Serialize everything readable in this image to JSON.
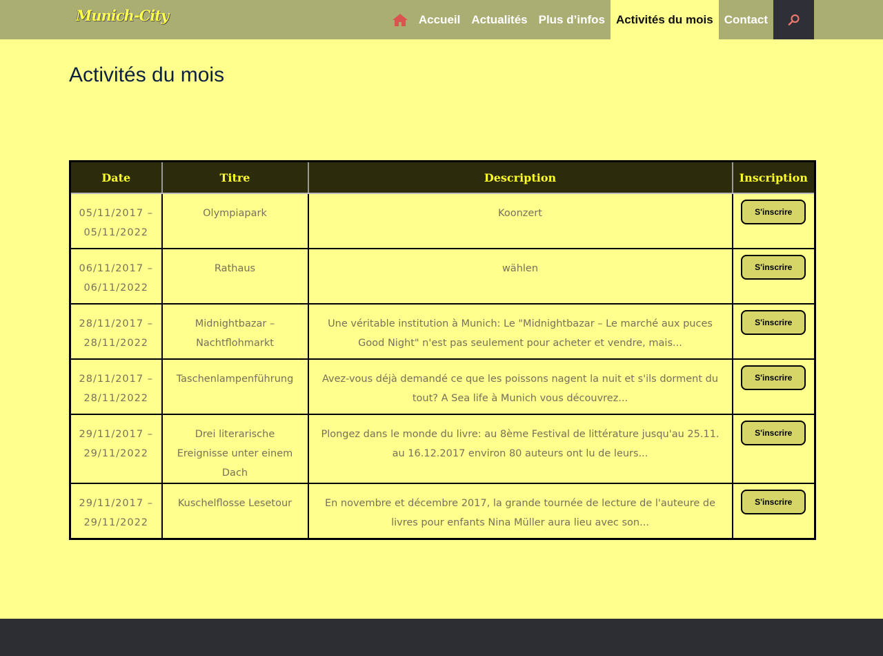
{
  "header": {
    "logo_text": "Munich-City",
    "nav": [
      {
        "label": "Accueil"
      },
      {
        "label": "Actualités"
      },
      {
        "label": "Plus d’infos"
      },
      {
        "label": "Activités du mois",
        "active": true
      },
      {
        "label": "Contact"
      }
    ],
    "icons": {
      "home": "home-icon",
      "search": "search-icon"
    },
    "colors": {
      "bar": "#abae73",
      "active_bg": "#ffff8e",
      "search_bg": "#2f3037",
      "home_icon": "#d9534f"
    }
  },
  "page": {
    "title": "Activités du mois",
    "background": "#ffff8e"
  },
  "table": {
    "headers": {
      "date": "Date",
      "title": "Titre",
      "description": "Description",
      "action": "Inscription"
    },
    "button_label": "S'inscrire",
    "rows": [
      {
        "date": "05/11/2017 – 05/11/2022",
        "title": "Olympiapark",
        "description": "Koonzert"
      },
      {
        "date": "06/11/2017 – 06/11/2022",
        "title": "Rathaus",
        "description": "wählen"
      },
      {
        "date": "28/11/2017 – 28/11/2022",
        "title": "Midnightbazar – Nachtflohmarkt",
        "description": "Une véritable institution à Munich: Le \"Midnightbazar – Le marché aux puces Good Night\" n'est pas seulement pour acheter et vendre, mais..."
      },
      {
        "date": "28/11/2017 – 28/11/2022",
        "title": "Taschenlampenführung",
        "description": "Avez-vous déjà demandé ce que les poissons nagent la nuit et s'ils dorment du tout? A Sea life à Munich vous découvrez..."
      },
      {
        "date": "29/11/2017 – 29/11/2022",
        "title": "Drei literarische Ereignisse unter einem Dach",
        "description": "Plongez dans le monde du livre: au 8ème Festival de littérature jusqu'au 25.11. au 16.12.2017 environ 80 auteurs ont lu de leurs..."
      },
      {
        "date": "29/11/2017 – 29/11/2022",
        "title": "Kuschelflosse Lesetour",
        "description": "En novembre et décembre 2017, la grande tournée de lecture de l'auteure de livres pour enfants Nina Müller aura lieu avec son..."
      }
    ]
  }
}
